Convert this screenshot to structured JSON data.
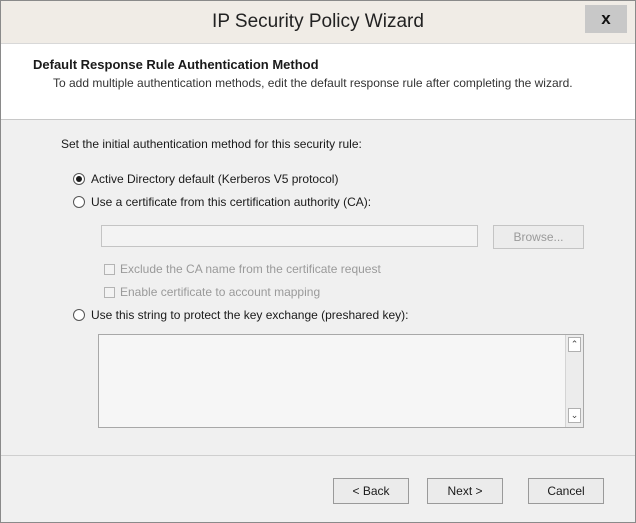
{
  "window": {
    "title": "IP Security Policy Wizard",
    "close_glyph": "x"
  },
  "header": {
    "title": "Default Response Rule Authentication Method",
    "description": "To add multiple authentication methods, edit the default response rule after completing the wizard."
  },
  "body": {
    "prompt": "Set the initial authentication method for this security rule:",
    "options": [
      {
        "label": "Active Directory default (Kerberos V5 protocol)",
        "selected": true
      },
      {
        "label": "Use a certificate from this certification authority (CA):",
        "selected": false
      },
      {
        "label": "Use this string to protect the key exchange (preshared key):",
        "selected": false
      }
    ],
    "ca_value": "",
    "browse_label": "Browse...",
    "checkboxes": [
      {
        "label": "Exclude the CA name from the certificate request",
        "checked": false,
        "enabled": false
      },
      {
        "label": "Enable certificate to account mapping",
        "checked": false,
        "enabled": false
      }
    ],
    "preshared_value": ""
  },
  "scroll_icons": {
    "up": "chevron-up-icon",
    "down": "chevron-down-icon"
  },
  "footer": {
    "back_label": "< Back",
    "next_label": "Next >",
    "cancel_label": "Cancel"
  }
}
